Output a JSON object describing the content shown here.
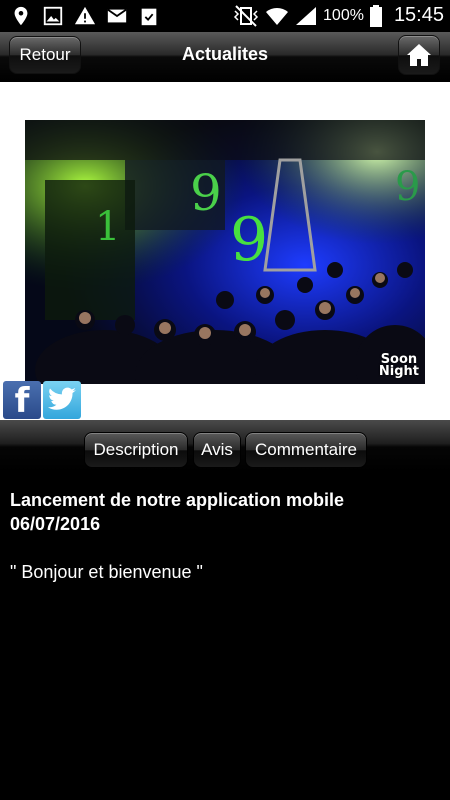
{
  "status_bar": {
    "battery_percent": "100%",
    "time": "15:45"
  },
  "header": {
    "back_label": "Retour",
    "title": "Actualites"
  },
  "photo": {
    "watermark_line1": "Soon",
    "watermark_line2": "Night"
  },
  "share": {
    "facebook_glyph": "f"
  },
  "tabs": [
    {
      "label": "Description"
    },
    {
      "label": "Avis"
    },
    {
      "label": "Commentaire"
    }
  ],
  "article": {
    "title": "Lancement de notre application mobile",
    "date": "06/07/2016",
    "body": "\" Bonjour et bienvenue \""
  },
  "colors": {
    "background": "#000000",
    "content_panel": "#ffffff",
    "facebook": "#3b5998",
    "twitter": "#55acee"
  }
}
